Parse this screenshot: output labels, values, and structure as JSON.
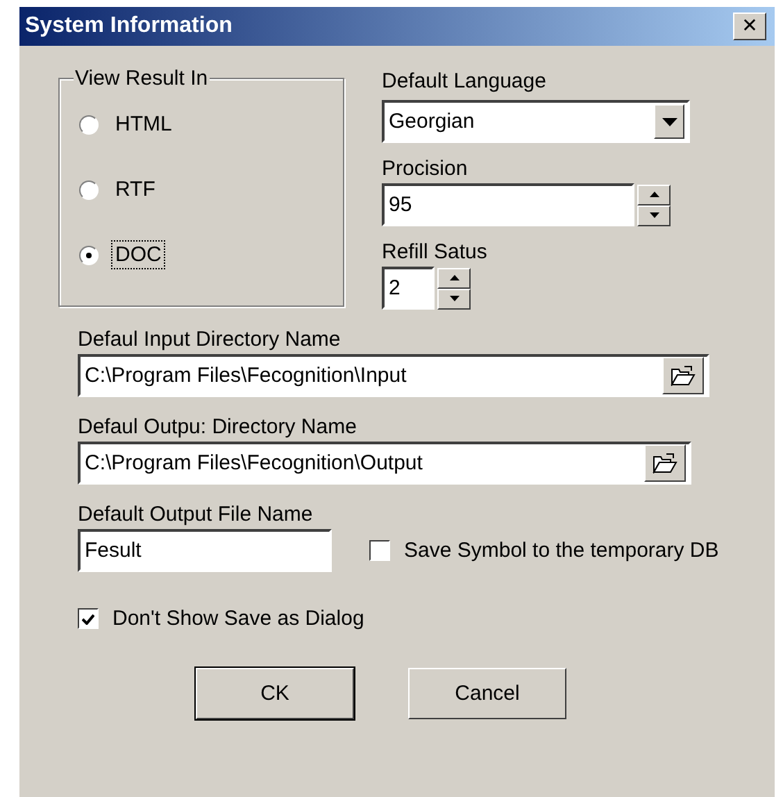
{
  "window": {
    "title": "System Information",
    "close": "✕"
  },
  "view_result_in": {
    "label": "View Result In",
    "options": [
      {
        "label": "HTML",
        "selected": false
      },
      {
        "label": "RTF",
        "selected": false
      },
      {
        "label": "DOC",
        "selected": true
      }
    ]
  },
  "default_language": {
    "label": "Default Language",
    "value": "Georgian"
  },
  "precision": {
    "label": "Procision",
    "value": "95"
  },
  "refill_status": {
    "label": "Refill Satus",
    "value": "2"
  },
  "input_directory": {
    "label": "Defaul Input Directory Name",
    "value": "C:\\Program Files\\Fecognition\\Input"
  },
  "output_directory": {
    "label": "Defaul Outpu: Directory Name",
    "value": "C:\\Program Files\\Fecognition\\Output"
  },
  "output_file": {
    "label": "Default Output File Name",
    "value": "Fesult"
  },
  "save_symbol": {
    "label": "Save Symbol to the temporary DB",
    "checked": false
  },
  "dont_show_dialog": {
    "label": "Don't Show Save as Dialog",
    "checked": true
  },
  "buttons": [
    {
      "label": "CK",
      "default": true
    },
    {
      "label": "Cancel",
      "default": false
    }
  ]
}
